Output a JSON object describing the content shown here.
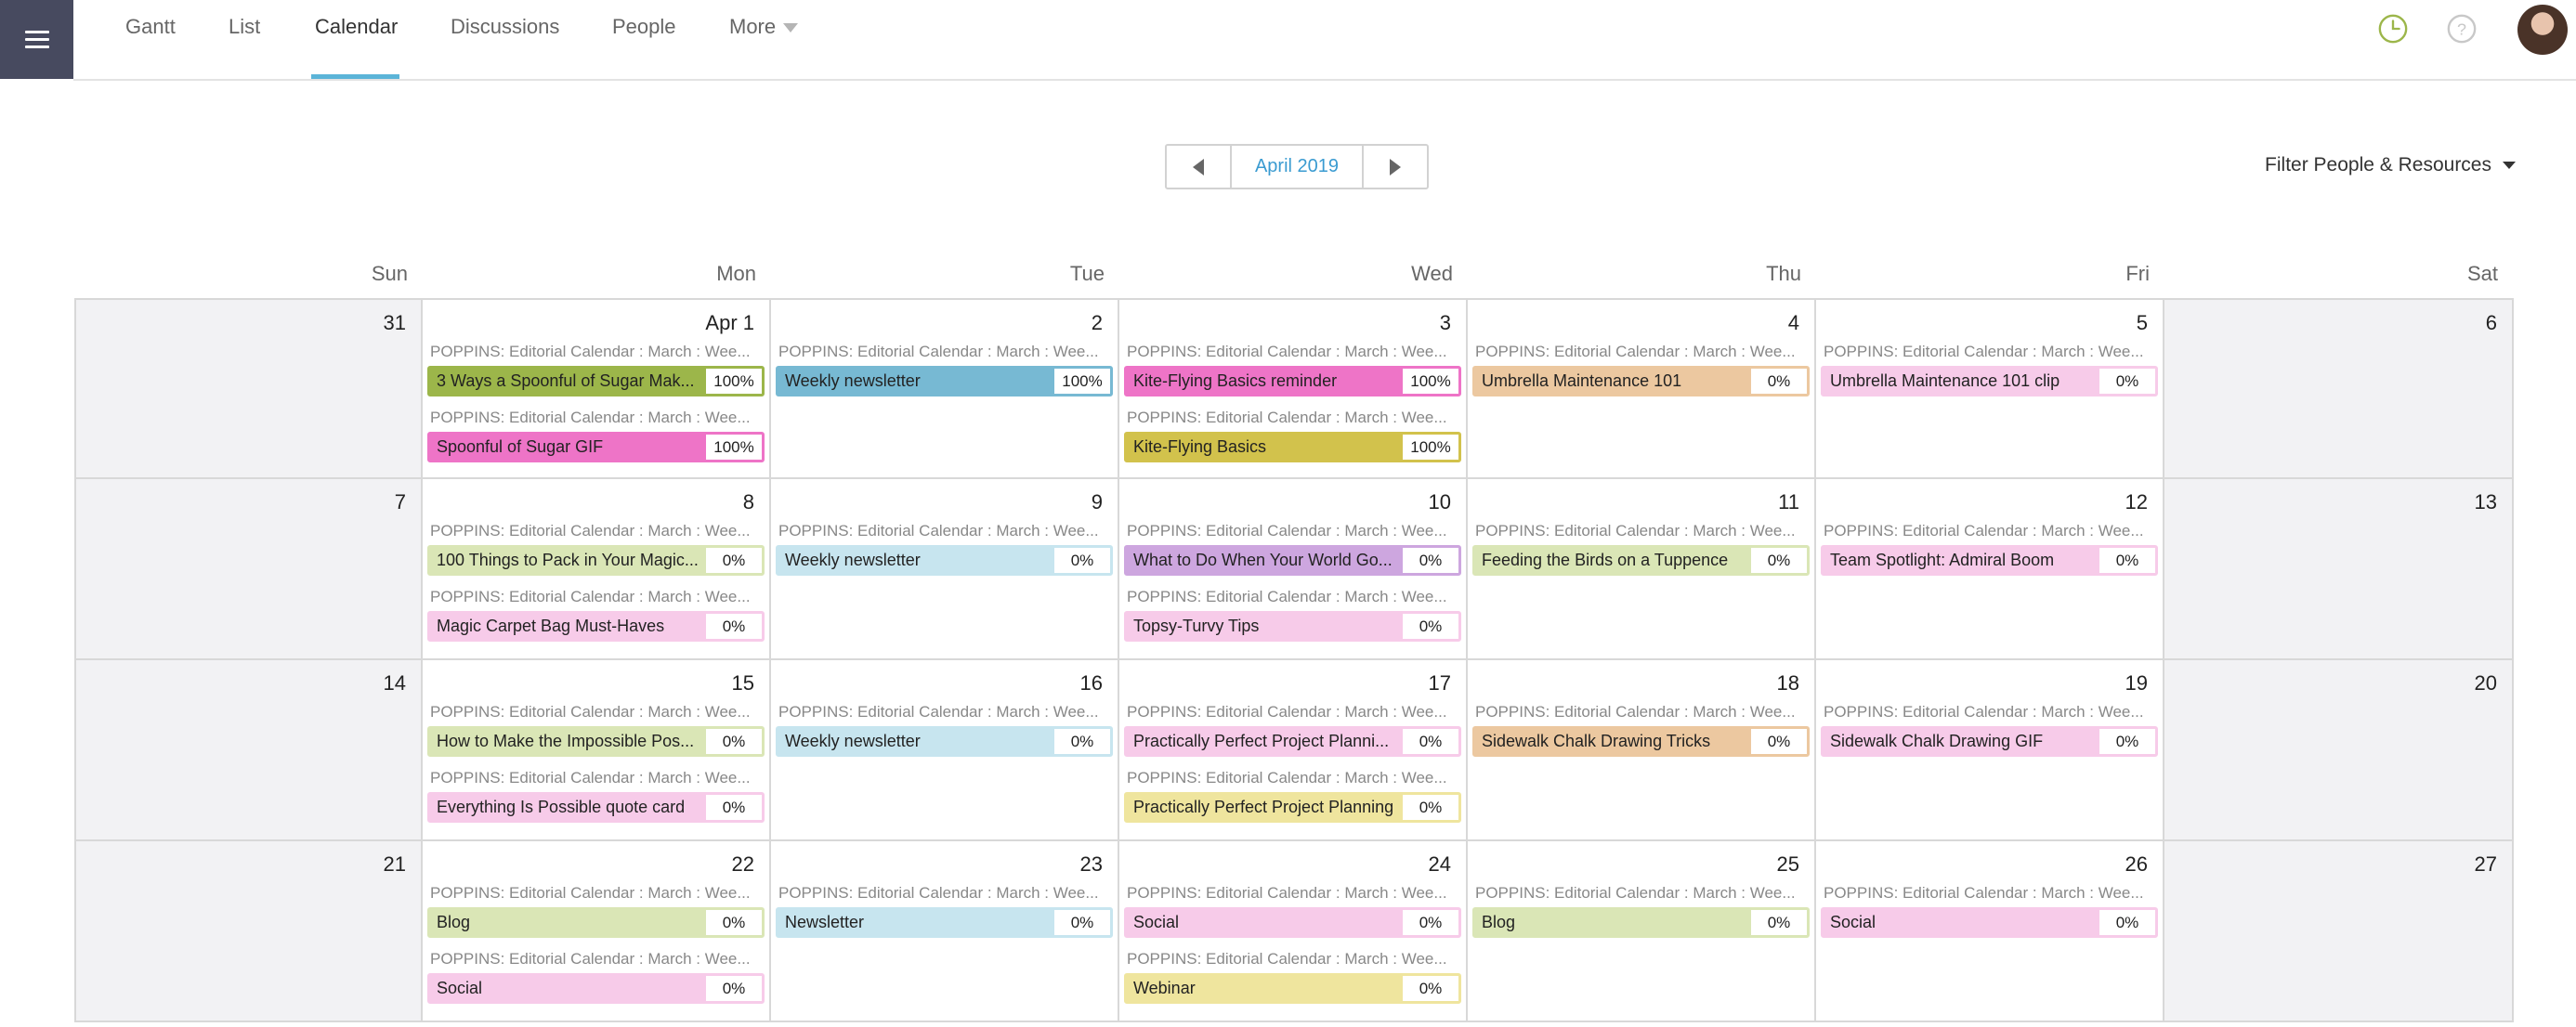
{
  "nav": {
    "tabs": [
      {
        "label": "Gantt"
      },
      {
        "label": "List"
      },
      {
        "label": "Calendar"
      },
      {
        "label": "Discussions"
      },
      {
        "label": "People"
      },
      {
        "label": "More"
      }
    ],
    "active_tab": "Calendar"
  },
  "header_icons": [
    "clock-icon",
    "help-icon",
    "avatar"
  ],
  "toolbar": {
    "month_label": "April 2019",
    "filter_label": "Filter People & Resources"
  },
  "weekdays": [
    "Sun",
    "Mon",
    "Tue",
    "Wed",
    "Thu",
    "Fri",
    "Sat"
  ],
  "context_label": "POPPINS: Editorial Calendar : March : Wee...",
  "colors": {
    "green_done": "#9cb64a",
    "blue_done": "#77b9d3",
    "pink_done": "#ee74c7",
    "yellow_done": "#d2c24c",
    "orange": "#ecc8a0",
    "pink_light": "#f7cbe9",
    "green_light": "#dae6b6",
    "blue_light": "#c7e5ef",
    "purple": "#cda6df",
    "yellow_light": "#efe59e"
  },
  "weeks": [
    {
      "days": [
        {
          "num": "31",
          "weekend": true,
          "tasks": []
        },
        {
          "num": "Apr 1",
          "tasks": [
            {
              "name": "3 Ways a Spoonful of Sugar Mak...",
              "pct": "100%",
              "color": "green_done"
            },
            {
              "name": "Spoonful of Sugar GIF",
              "pct": "100%",
              "color": "pink_done"
            }
          ]
        },
        {
          "num": "2",
          "tasks": [
            {
              "name": "Weekly newsletter",
              "pct": "100%",
              "color": "blue_done"
            }
          ]
        },
        {
          "num": "3",
          "tasks": [
            {
              "name": "Kite-Flying Basics reminder",
              "pct": "100%",
              "color": "pink_done"
            },
            {
              "name": "Kite-Flying Basics",
              "pct": "100%",
              "color": "yellow_done"
            }
          ]
        },
        {
          "num": "4",
          "tasks": [
            {
              "name": "Umbrella Maintenance 101",
              "pct": "0%",
              "color": "orange"
            }
          ]
        },
        {
          "num": "5",
          "tasks": [
            {
              "name": "Umbrella Maintenance 101 clip",
              "pct": "0%",
              "color": "pink_light"
            }
          ]
        },
        {
          "num": "6",
          "weekend": true,
          "tasks": []
        }
      ]
    },
    {
      "days": [
        {
          "num": "7",
          "weekend": true,
          "tasks": []
        },
        {
          "num": "8",
          "tasks": [
            {
              "name": "100 Things to Pack in Your Magic...",
              "pct": "0%",
              "color": "green_light"
            },
            {
              "name": "Magic Carpet Bag Must-Haves",
              "pct": "0%",
              "color": "pink_light"
            }
          ]
        },
        {
          "num": "9",
          "tasks": [
            {
              "name": "Weekly newsletter",
              "pct": "0%",
              "color": "blue_light"
            }
          ]
        },
        {
          "num": "10",
          "tasks": [
            {
              "name": "What to Do When Your World Go...",
              "pct": "0%",
              "color": "purple"
            },
            {
              "name": "Topsy-Turvy Tips",
              "pct": "0%",
              "color": "pink_light"
            }
          ]
        },
        {
          "num": "11",
          "tasks": [
            {
              "name": "Feeding the Birds on a Tuppence",
              "pct": "0%",
              "color": "green_light"
            }
          ]
        },
        {
          "num": "12",
          "tasks": [
            {
              "name": "Team Spotlight: Admiral Boom",
              "pct": "0%",
              "color": "pink_light"
            }
          ]
        },
        {
          "num": "13",
          "weekend": true,
          "tasks": []
        }
      ]
    },
    {
      "days": [
        {
          "num": "14",
          "weekend": true,
          "tasks": []
        },
        {
          "num": "15",
          "tasks": [
            {
              "name": "How to Make the Impossible Pos...",
              "pct": "0%",
              "color": "green_light"
            },
            {
              "name": "Everything Is Possible quote card",
              "pct": "0%",
              "color": "pink_light"
            }
          ]
        },
        {
          "num": "16",
          "tasks": [
            {
              "name": "Weekly newsletter",
              "pct": "0%",
              "color": "blue_light"
            }
          ]
        },
        {
          "num": "17",
          "tasks": [
            {
              "name": "Practically Perfect Project Planni...",
              "pct": "0%",
              "color": "pink_light"
            },
            {
              "name": "Practically Perfect Project Planning",
              "pct": "0%",
              "color": "yellow_light"
            }
          ]
        },
        {
          "num": "18",
          "tasks": [
            {
              "name": "Sidewalk Chalk Drawing Tricks",
              "pct": "0%",
              "color": "orange"
            }
          ]
        },
        {
          "num": "19",
          "tasks": [
            {
              "name": "Sidewalk Chalk Drawing GIF",
              "pct": "0%",
              "color": "pink_light"
            }
          ]
        },
        {
          "num": "20",
          "weekend": true,
          "tasks": []
        }
      ]
    },
    {
      "days": [
        {
          "num": "21",
          "weekend": true,
          "tasks": []
        },
        {
          "num": "22",
          "tasks": [
            {
              "name": "Blog",
              "pct": "0%",
              "color": "green_light"
            },
            {
              "name": "Social",
              "pct": "0%",
              "color": "pink_light"
            }
          ]
        },
        {
          "num": "23",
          "tasks": [
            {
              "name": "Newsletter",
              "pct": "0%",
              "color": "blue_light"
            }
          ]
        },
        {
          "num": "24",
          "tasks": [
            {
              "name": "Social",
              "pct": "0%",
              "color": "pink_light"
            },
            {
              "name": "Webinar",
              "pct": "0%",
              "color": "yellow_light"
            }
          ]
        },
        {
          "num": "25",
          "tasks": [
            {
              "name": "Blog",
              "pct": "0%",
              "color": "green_light"
            }
          ]
        },
        {
          "num": "26",
          "tasks": [
            {
              "name": "Social",
              "pct": "0%",
              "color": "pink_light"
            }
          ]
        },
        {
          "num": "27",
          "weekend": true,
          "tasks": []
        }
      ]
    }
  ]
}
